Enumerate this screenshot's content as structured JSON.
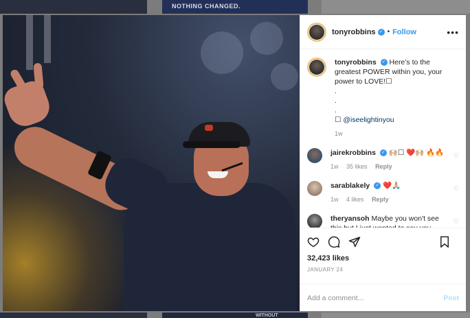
{
  "backdrop": {
    "thumb_text_top": "NOTHING CHANGED.",
    "thumb_text_bottom": "WITHOUT"
  },
  "post": {
    "author": "tonyrobbins",
    "verified_icon": "verified-badge-icon",
    "separator": "•",
    "follow_label": "Follow",
    "more_label": "•••",
    "caption": {
      "username": "tonyrobbins",
      "text": "Here’s to the greatest POWER within you, your power to LOVE!☐",
      "dots": [
        ".",
        ".",
        "."
      ],
      "mention_prefix": "☐ ",
      "mention": "@iseelightinyou",
      "age": "1w"
    },
    "comments": [
      {
        "username": "jairekrobbins",
        "verified": true,
        "text": "🙌🏼☐ ❤️🙌🏼 🔥🔥",
        "age": "1w",
        "likes": "35 likes",
        "reply": "Reply"
      },
      {
        "username": "sarablakely",
        "verified": true,
        "text": "❤️🙏🏼",
        "age": "1w",
        "likes": "4 likes",
        "reply": "Reply"
      },
      {
        "username": "theryansoh",
        "verified": false,
        "text": "Maybe you won't see this but I just wanted to say you",
        "age": "",
        "likes": "",
        "reply": ""
      }
    ],
    "like_count": "32,423 likes",
    "date": "JANUARY 24",
    "comment_placeholder": "Add a comment...",
    "post_label": "Post"
  },
  "colors": {
    "link_blue": "#3897f0",
    "post_disabled": "#b2dffc",
    "muted": "#8e8e8e",
    "text": "#262626"
  }
}
